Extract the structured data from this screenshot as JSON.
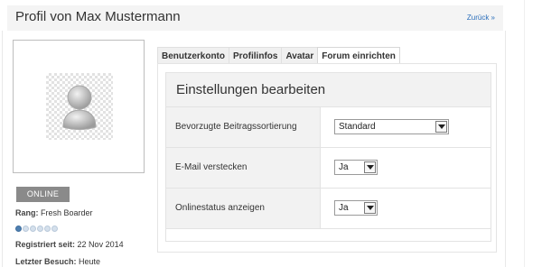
{
  "header": {
    "title": "Profil von Max Mustermann",
    "back_label": "Zurück »"
  },
  "sidebar": {
    "status": "ONLINE",
    "rank_label": "Rang:",
    "rank_value": "Fresh Boarder",
    "rank_level": {
      "filled": 1,
      "total": 6
    },
    "registered_label": "Registriert seit:",
    "registered_value": "22 Nov 2014",
    "last_visit_label": "Letzter Besuch:",
    "last_visit_value": "Heute"
  },
  "tabs": [
    {
      "label": "Benutzerkonto",
      "active": false
    },
    {
      "label": "Profilinfos",
      "active": false
    },
    {
      "label": "Avatar",
      "active": false
    },
    {
      "label": "Forum einrichten",
      "active": true
    }
  ],
  "settings": {
    "title": "Einstellungen bearbeiten",
    "rows": [
      {
        "label": "Bevorzugte Beitragssortierung",
        "value": "Standard"
      },
      {
        "label": "E-Mail verstecken",
        "value": "Ja"
      },
      {
        "label": "Onlinestatus anzeigen",
        "value": "Ja"
      }
    ]
  }
}
